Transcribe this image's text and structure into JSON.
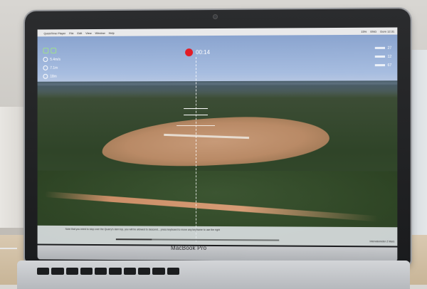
{
  "menubar": {
    "apple_glyph": "",
    "items": [
      "QuickTime Player",
      "File",
      "Edit",
      "View",
      "Window",
      "Help"
    ],
    "status_items": [
      "15%",
      "ENG",
      "Dom 12:31"
    ]
  },
  "video_hud": {
    "timer": "00:14",
    "left_values": [
      "5.4m/s",
      "7.1m",
      "18m"
    ],
    "right_values": [
      "27",
      "12",
      "67"
    ],
    "progress_fraction": 0.22
  },
  "caption": {
    "text": "Note that you need to stop over the Quarry's dam top, you will be allowed to descend... press keyboard to move any keyframe to use the right",
    "right_text": "Intervalometer Z Mars"
  },
  "laptop": {
    "brand": "MacBook Pro"
  },
  "colors": {
    "rec": "#e21c25",
    "sky": "#a7bde0",
    "clearing": "#c79a78"
  },
  "icons": [
    "apple-icon",
    "record-icon",
    "gps-icon",
    "battery-icon",
    "camera-icon"
  ]
}
